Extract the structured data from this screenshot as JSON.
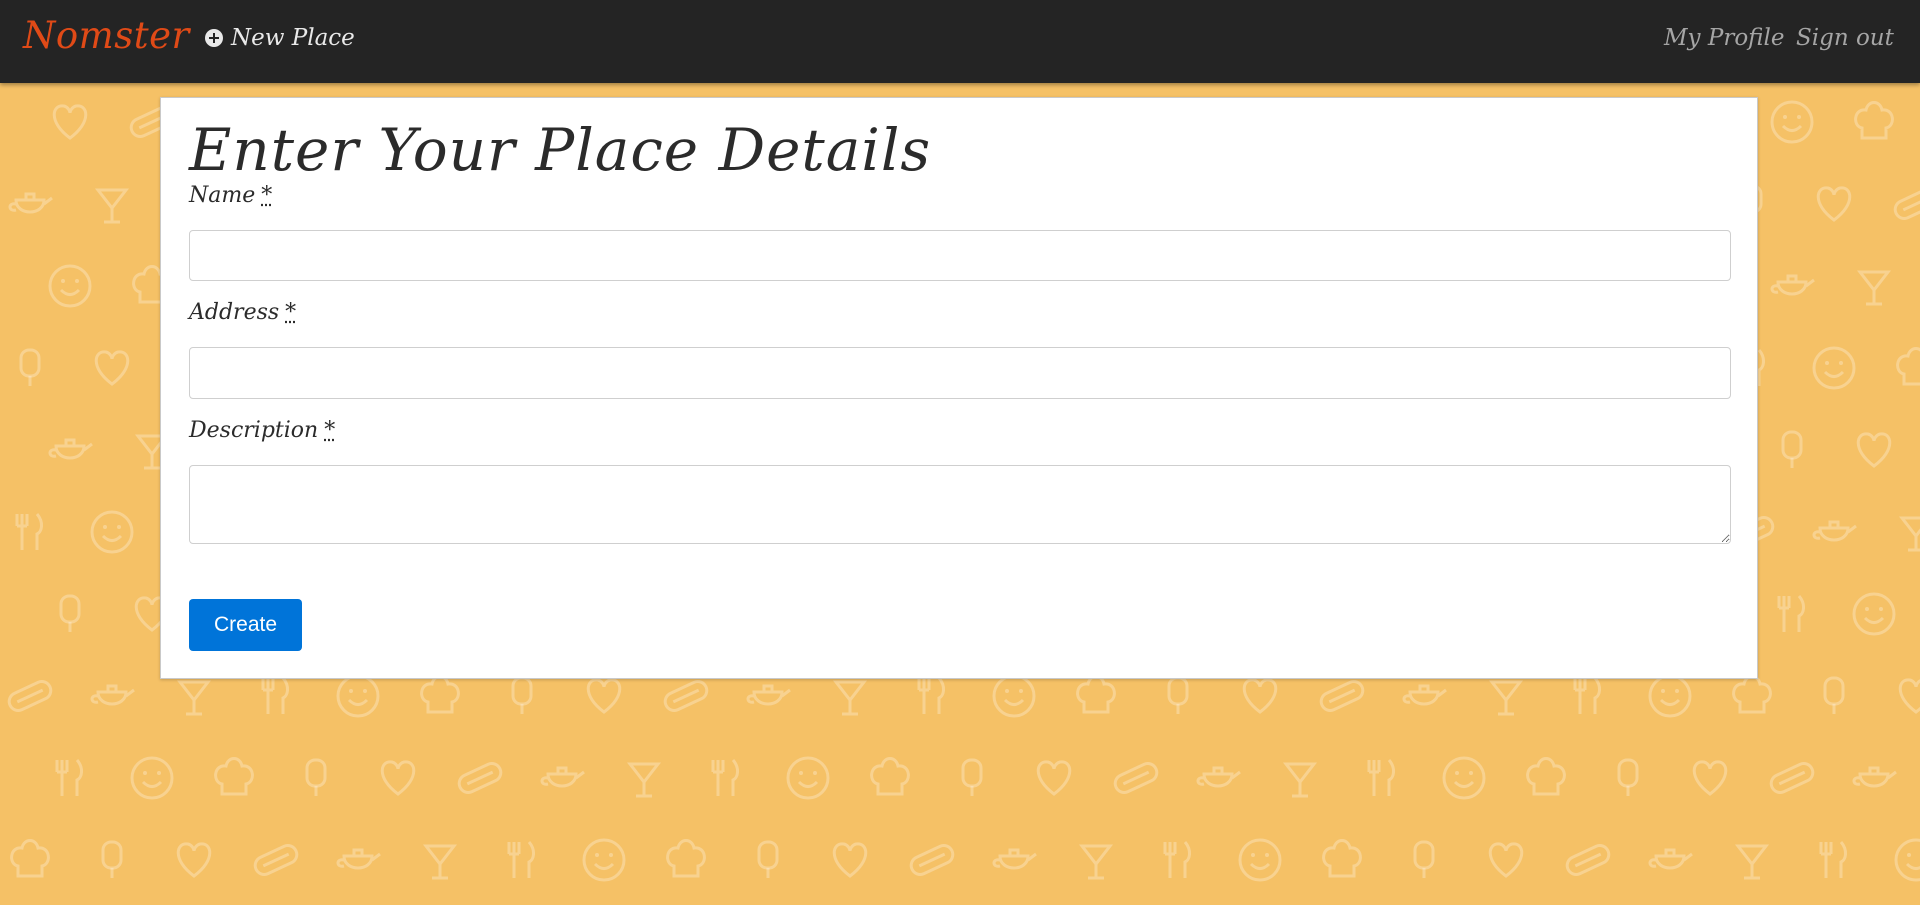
{
  "theme": {
    "accent": "#e04a17",
    "navbar_bg": "#242424",
    "page_bg": "#f5c166",
    "button_bg": "#0074d9"
  },
  "navbar": {
    "brand": "Nomster",
    "new_place": {
      "label": "New Place",
      "icon": "plus-circle-icon"
    },
    "my_profile": "My Profile",
    "sign_out": "Sign out"
  },
  "form": {
    "title": "Enter Your Place Details",
    "fields": [
      {
        "label": "Name",
        "required_mark": "*",
        "value": "",
        "placeholder": ""
      },
      {
        "label": "Address",
        "required_mark": "*",
        "value": "",
        "placeholder": ""
      },
      {
        "label": "Description",
        "required_mark": "*",
        "value": "",
        "placeholder": ""
      }
    ],
    "submit_label": "Create"
  }
}
